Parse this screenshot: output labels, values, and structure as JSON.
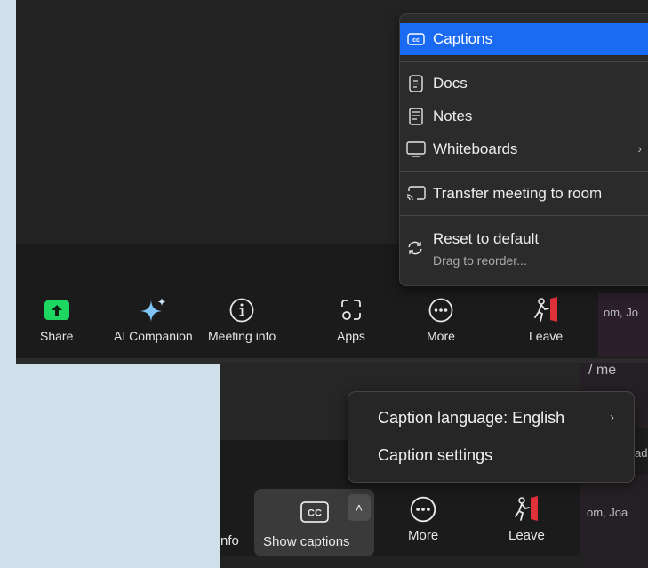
{
  "top_toolbar": {
    "share_label": "Share",
    "ai_companion_label": "AI Companion",
    "meeting_info_label": "Meeting info",
    "apps_label": "Apps",
    "more_label": "More",
    "leave_label": "Leave",
    "peek_text": "om,   Jo"
  },
  "more_menu": {
    "captions": "Captions",
    "docs": "Docs",
    "notes": "Notes",
    "whiteboards": "Whiteboards",
    "transfer": "Transfer meeting to room",
    "reset": "Reset to default",
    "reset_hint": "Drag to reorder..."
  },
  "caption_menu": {
    "language": "Caption language: English",
    "settings": "Caption settings"
  },
  "bottom_toolbar": {
    "info_label": "nfo",
    "show_captions_label": "Show captions",
    "more_label": "More",
    "leave_label": "Leave",
    "peek_top": "/ me",
    "peek_mid": "ad",
    "peek_bottom": "om,    Joa"
  },
  "colors": {
    "accent": "#1a6bf2",
    "share_green": "#1ed760",
    "leave_red": "#e0303a"
  }
}
